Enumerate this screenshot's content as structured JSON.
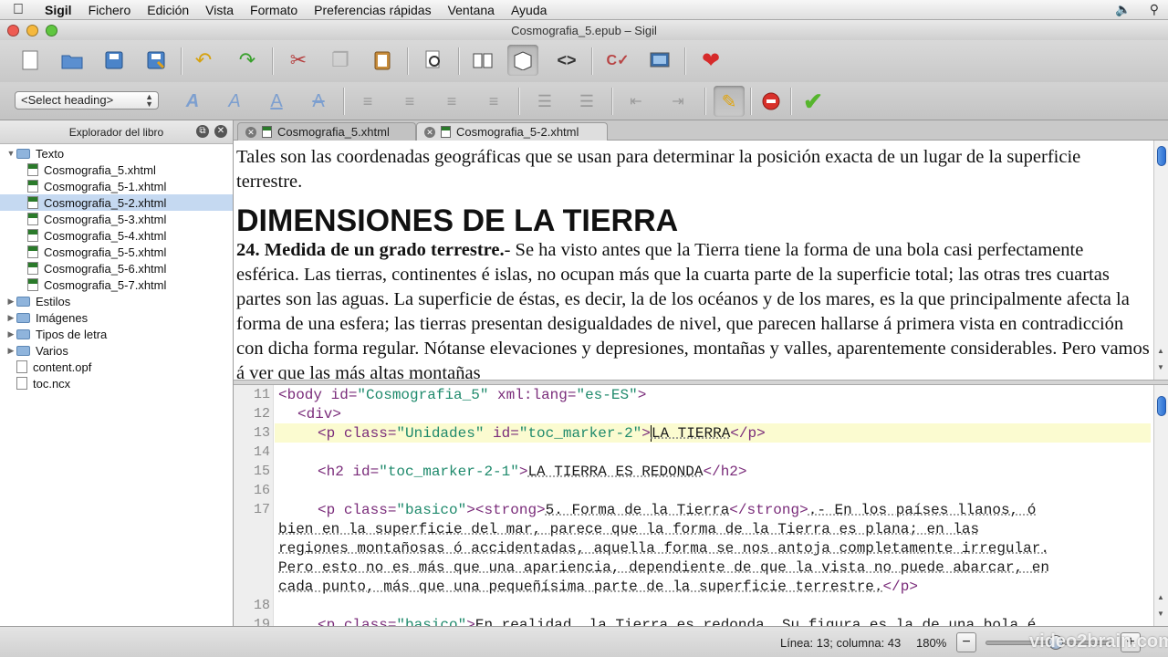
{
  "menubar": {
    "apple": "",
    "items": [
      "Sigil",
      "Fichero",
      "Edición",
      "Vista",
      "Formato",
      "Preferencias rápidas",
      "Ventana",
      "Ayuda"
    ]
  },
  "window": {
    "title": "Cosmografia_5.epub – Sigil"
  },
  "toolbar2": {
    "heading_select": "<Select heading>"
  },
  "sidebar": {
    "title": "Explorador del libro",
    "tree": [
      {
        "label": "Texto",
        "type": "folder",
        "expanded": true
      },
      {
        "label": "Cosmografia_5.xhtml",
        "type": "file"
      },
      {
        "label": "Cosmografia_5-1.xhtml",
        "type": "file"
      },
      {
        "label": "Cosmografia_5-2.xhtml",
        "type": "file",
        "selected": true
      },
      {
        "label": "Cosmografia_5-3.xhtml",
        "type": "file"
      },
      {
        "label": "Cosmografia_5-4.xhtml",
        "type": "file"
      },
      {
        "label": "Cosmografia_5-5.xhtml",
        "type": "file"
      },
      {
        "label": "Cosmografia_5-6.xhtml",
        "type": "file"
      },
      {
        "label": "Cosmografia_5-7.xhtml",
        "type": "file"
      },
      {
        "label": "Estilos",
        "type": "folder"
      },
      {
        "label": "Imágenes",
        "type": "folder"
      },
      {
        "label": "Tipos de letra",
        "type": "folder"
      },
      {
        "label": "Varios",
        "type": "folder"
      },
      {
        "label": "content.opf",
        "type": "plain"
      },
      {
        "label": "toc.ncx",
        "type": "plain"
      }
    ]
  },
  "tabs": [
    {
      "label": "Cosmografia_5.xhtml",
      "active": false
    },
    {
      "label": "Cosmografia_5-2.xhtml",
      "active": true
    }
  ],
  "bookview": {
    "intro": "Tales son las coordenadas geográficas que se usan para determinar la posición exacta de un lugar de la superficie terrestre.",
    "heading": "DIMENSIONES DE LA TIERRA",
    "para_bold": "24. Medida de un grado terrestre.",
    "para_text": "- Se ha visto antes que la Tierra tiene la forma de una bola casi perfectamente esférica. Las tierras, continentes é islas, no ocupan más que la cuarta parte de la superficie total; las otras tres cuartas partes son las aguas. La superficie de éstas, es decir, la de los océanos y de los mares, es la que principalmente afecta la forma de una esfera; las tierras presentan desigualdades de nivel, que parecen hallarse á primera vista en contradicción con dicha forma regular. Nótanse elevaciones y depresiones, montañas y valles, aparentemente considerables. Pero vamos á ver que las más altas montañas"
  },
  "code": {
    "line_numbers": [
      "11",
      "12",
      "13",
      "14",
      "15",
      "16",
      "17",
      "18",
      "19"
    ],
    "l11": [
      "<body ",
      "id=",
      "\"Cosmografia_5\"",
      " xml:lang=",
      "\"es-ES\"",
      ">"
    ],
    "l12": "<div>",
    "l13": [
      "<p ",
      "class=",
      "\"Unidades\"",
      " id=",
      "\"toc_marker-2\"",
      ">",
      "LA TIERRA",
      "</p>"
    ],
    "l15": [
      "<h2 ",
      "id=",
      "\"toc_marker-2-1\"",
      ">",
      "LA TIERRA ES REDONDA",
      "</h2>"
    ],
    "l17a": [
      "<p ",
      "class=",
      "\"basico\"",
      "><strong>",
      "5. Forma de la Tierra",
      "</strong>",
      ".- En los países llanos, ó"
    ],
    "l17b": "bien en la superficie del mar, parece que la forma de la Tierra es plana; en las",
    "l17c": "regiones montañosas ó accidentadas, aquella forma se nos antoja completamente irregular.",
    "l17d": "Pero esto no es más que una apariencia, dependiente de que la vista no puede abarcar, en",
    "l17e": [
      "cada punto, más que una pequeñísima parte de la superficie terrestre.",
      "</p>"
    ],
    "l19": [
      "<p ",
      "class=",
      "\"basico\"",
      ">",
      "En realidad, la Tierra es redonda. Su figura es la de una bola é"
    ]
  },
  "status": {
    "position": "Línea: 13; columna: 43",
    "zoom": "180%",
    "zoom_level_fraction": 0.55,
    "zoom_out": "−",
    "zoom_in": "+"
  },
  "watermark": "video2brain.com",
  "colors": {
    "selection": "#c5d9f1",
    "current_line": "#fbfbd0",
    "tag": "#7a2c7a",
    "value": "#1f8a6c"
  }
}
